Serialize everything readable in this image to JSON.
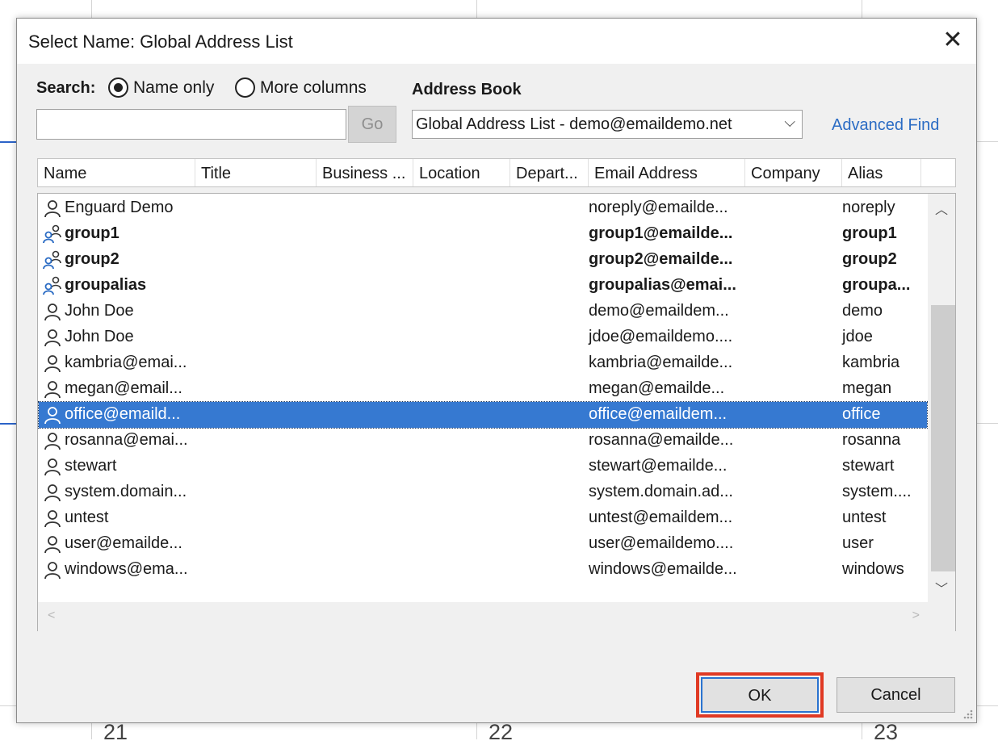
{
  "dialog": {
    "title": "Select Name: Global Address List",
    "close_glyph": "✕"
  },
  "search": {
    "label": "Search:",
    "input_value": "",
    "options": [
      {
        "label": "Name only",
        "checked": true
      },
      {
        "label": "More columns",
        "checked": false
      }
    ],
    "go_label": "Go"
  },
  "address_book": {
    "label": "Address Book",
    "selected": "Global Address List - demo@emaildemo.net",
    "advanced_find": "Advanced Find"
  },
  "columns": [
    "Name",
    "Title",
    "Business ...",
    "Location",
    "Depart...",
    "Email Address",
    "Company",
    "Alias"
  ],
  "rows": [
    {
      "icon": "user-icon",
      "name": "Enguard Demo",
      "email": "noreply@emailde...",
      "alias": "noreply",
      "bold": false,
      "selected": false
    },
    {
      "icon": "group-icon",
      "name": "group1",
      "email": "group1@emailde...",
      "alias": "group1",
      "bold": true,
      "selected": false
    },
    {
      "icon": "group-icon",
      "name": "group2",
      "email": "group2@emailde...",
      "alias": "group2",
      "bold": true,
      "selected": false
    },
    {
      "icon": "group-icon",
      "name": "groupalias",
      "email": "groupalias@emai...",
      "alias": "groupa...",
      "bold": true,
      "selected": false
    },
    {
      "icon": "user-icon",
      "name": "John Doe",
      "email": "demo@emaildem...",
      "alias": "demo",
      "bold": false,
      "selected": false
    },
    {
      "icon": "user-icon",
      "name": "John Doe",
      "email": "jdoe@emaildemo....",
      "alias": "jdoe",
      "bold": false,
      "selected": false
    },
    {
      "icon": "user-icon",
      "name": "kambria@emai...",
      "email": "kambria@emailde...",
      "alias": "kambria",
      "bold": false,
      "selected": false
    },
    {
      "icon": "user-icon",
      "name": "megan@email...",
      "email": "megan@emailde...",
      "alias": "megan",
      "bold": false,
      "selected": false
    },
    {
      "icon": "user-icon",
      "name": "office@emaild...",
      "email": "office@emaildem...",
      "alias": "office",
      "bold": false,
      "selected": true
    },
    {
      "icon": "user-icon",
      "name": "rosanna@emai...",
      "email": "rosanna@emailde...",
      "alias": "rosanna",
      "bold": false,
      "selected": false
    },
    {
      "icon": "user-icon",
      "name": "stewart",
      "email": "stewart@emailde...",
      "alias": "stewart",
      "bold": false,
      "selected": false
    },
    {
      "icon": "user-icon",
      "name": "system.domain...",
      "email": "system.domain.ad...",
      "alias": "system....",
      "bold": false,
      "selected": false
    },
    {
      "icon": "user-icon",
      "name": "untest",
      "email": "untest@emaildem...",
      "alias": "untest",
      "bold": false,
      "selected": false
    },
    {
      "icon": "user-icon",
      "name": "user@emailde...",
      "email": "user@emaildemo....",
      "alias": "user",
      "bold": false,
      "selected": false
    },
    {
      "icon": "user-icon",
      "name": "windows@ema...",
      "email": "windows@emailde...",
      "alias": "windows",
      "bold": false,
      "selected": false
    }
  ],
  "buttons": {
    "ok": "OK",
    "cancel": "Cancel"
  },
  "background": {
    "day_numbers": [
      "21",
      "22",
      "23"
    ]
  },
  "colors": {
    "selection": "#3679d1",
    "link": "#2b6cc4",
    "highlight": "#e03a24",
    "group_icon_accent": "#2b6cc4"
  }
}
